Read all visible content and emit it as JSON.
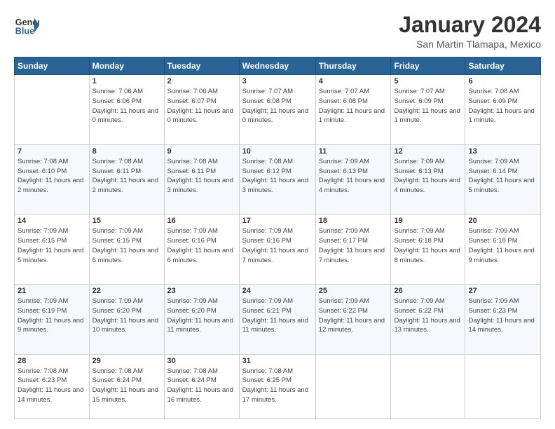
{
  "logo": {
    "line1": "General",
    "line2": "Blue",
    "icon": "▶"
  },
  "header": {
    "month": "January 2024",
    "location": "San Martin Tlamapa, Mexico"
  },
  "weekdays": [
    "Sunday",
    "Monday",
    "Tuesday",
    "Wednesday",
    "Thursday",
    "Friday",
    "Saturday"
  ],
  "weeks": [
    [
      {
        "day": "",
        "empty": true
      },
      {
        "day": "1",
        "sunrise": "7:06 AM",
        "sunset": "6:06 PM",
        "daylight": "11 hours and 0 minutes."
      },
      {
        "day": "2",
        "sunrise": "7:06 AM",
        "sunset": "6:07 PM",
        "daylight": "11 hours and 0 minutes."
      },
      {
        "day": "3",
        "sunrise": "7:07 AM",
        "sunset": "6:08 PM",
        "daylight": "11 hours and 0 minutes."
      },
      {
        "day": "4",
        "sunrise": "7:07 AM",
        "sunset": "6:08 PM",
        "daylight": "11 hours and 1 minute."
      },
      {
        "day": "5",
        "sunrise": "7:07 AM",
        "sunset": "6:09 PM",
        "daylight": "11 hours and 1 minute."
      },
      {
        "day": "6",
        "sunrise": "7:08 AM",
        "sunset": "6:09 PM",
        "daylight": "11 hours and 1 minute."
      }
    ],
    [
      {
        "day": "7",
        "sunrise": "7:08 AM",
        "sunset": "6:10 PM",
        "daylight": "11 hours and 2 minutes."
      },
      {
        "day": "8",
        "sunrise": "7:08 AM",
        "sunset": "6:11 PM",
        "daylight": "11 hours and 2 minutes."
      },
      {
        "day": "9",
        "sunrise": "7:08 AM",
        "sunset": "6:11 PM",
        "daylight": "11 hours and 3 minutes."
      },
      {
        "day": "10",
        "sunrise": "7:08 AM",
        "sunset": "6:12 PM",
        "daylight": "11 hours and 3 minutes."
      },
      {
        "day": "11",
        "sunrise": "7:09 AM",
        "sunset": "6:13 PM",
        "daylight": "11 hours and 4 minutes."
      },
      {
        "day": "12",
        "sunrise": "7:09 AM",
        "sunset": "6:13 PM",
        "daylight": "11 hours and 4 minutes."
      },
      {
        "day": "13",
        "sunrise": "7:09 AM",
        "sunset": "6:14 PM",
        "daylight": "11 hours and 5 minutes."
      }
    ],
    [
      {
        "day": "14",
        "sunrise": "7:09 AM",
        "sunset": "6:15 PM",
        "daylight": "11 hours and 5 minutes."
      },
      {
        "day": "15",
        "sunrise": "7:09 AM",
        "sunset": "6:15 PM",
        "daylight": "11 hours and 6 minutes."
      },
      {
        "day": "16",
        "sunrise": "7:09 AM",
        "sunset": "6:16 PM",
        "daylight": "11 hours and 6 minutes."
      },
      {
        "day": "17",
        "sunrise": "7:09 AM",
        "sunset": "6:16 PM",
        "daylight": "11 hours and 7 minutes."
      },
      {
        "day": "18",
        "sunrise": "7:09 AM",
        "sunset": "6:17 PM",
        "daylight": "11 hours and 7 minutes."
      },
      {
        "day": "19",
        "sunrise": "7:09 AM",
        "sunset": "6:18 PM",
        "daylight": "11 hours and 8 minutes."
      },
      {
        "day": "20",
        "sunrise": "7:09 AM",
        "sunset": "6:18 PM",
        "daylight": "11 hours and 9 minutes."
      }
    ],
    [
      {
        "day": "21",
        "sunrise": "7:09 AM",
        "sunset": "6:19 PM",
        "daylight": "11 hours and 9 minutes."
      },
      {
        "day": "22",
        "sunrise": "7:09 AM",
        "sunset": "6:20 PM",
        "daylight": "11 hours and 10 minutes."
      },
      {
        "day": "23",
        "sunrise": "7:09 AM",
        "sunset": "6:20 PM",
        "daylight": "11 hours and 11 minutes."
      },
      {
        "day": "24",
        "sunrise": "7:09 AM",
        "sunset": "6:21 PM",
        "daylight": "11 hours and 11 minutes."
      },
      {
        "day": "25",
        "sunrise": "7:09 AM",
        "sunset": "6:22 PM",
        "daylight": "11 hours and 12 minutes."
      },
      {
        "day": "26",
        "sunrise": "7:09 AM",
        "sunset": "6:22 PM",
        "daylight": "11 hours and 13 minutes."
      },
      {
        "day": "27",
        "sunrise": "7:09 AM",
        "sunset": "6:23 PM",
        "daylight": "11 hours and 14 minutes."
      }
    ],
    [
      {
        "day": "28",
        "sunrise": "7:08 AM",
        "sunset": "6:23 PM",
        "daylight": "11 hours and 14 minutes."
      },
      {
        "day": "29",
        "sunrise": "7:08 AM",
        "sunset": "6:24 PM",
        "daylight": "11 hours and 15 minutes."
      },
      {
        "day": "30",
        "sunrise": "7:08 AM",
        "sunset": "6:24 PM",
        "daylight": "11 hours and 16 minutes."
      },
      {
        "day": "31",
        "sunrise": "7:08 AM",
        "sunset": "6:25 PM",
        "daylight": "11 hours and 17 minutes."
      },
      {
        "day": "",
        "empty": true
      },
      {
        "day": "",
        "empty": true
      },
      {
        "day": "",
        "empty": true
      }
    ]
  ]
}
